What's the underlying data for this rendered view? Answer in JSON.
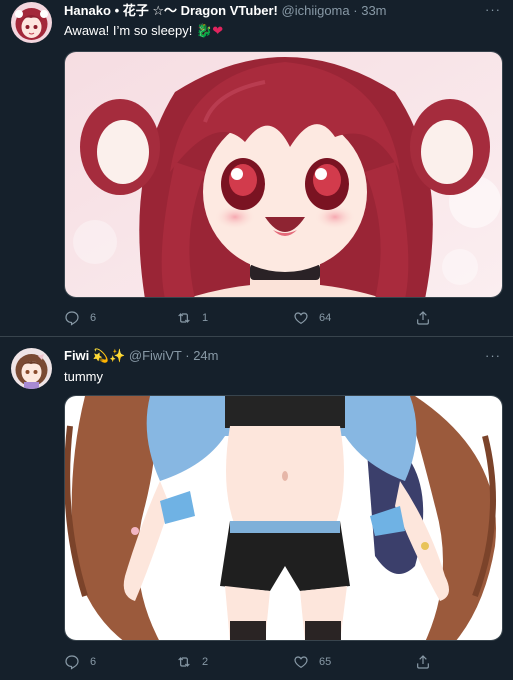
{
  "tweets": [
    {
      "name": "Hanako • 花子 ☆〜 Dragon VTuber!",
      "handle": "@ichiigoma",
      "separator": "·",
      "time": "33m",
      "text": "Awawa! I’m so sleepy!",
      "text_emoji_1": "🐉",
      "text_emoji_2": "❤",
      "more": "···",
      "replies": "6",
      "retweets": "1",
      "likes": "64",
      "avatar_icon": "avatar-red-hair-girl",
      "media_description_icon": "anime-girl-red-hair-image"
    },
    {
      "name": "Fiwi",
      "name_emoji": "💫✨",
      "handle": "@FiwiVT",
      "separator": "·",
      "time": "24m",
      "text": "tummy",
      "more": "···",
      "replies": "6",
      "retweets": "2",
      "likes": "65",
      "avatar_icon": "avatar-brown-hair-girl",
      "media_description_icon": "anime-girl-brown-hair-image"
    }
  ],
  "colors": {
    "background": "#15202b",
    "secondary_text": "#8899a6",
    "border": "#38444d"
  }
}
